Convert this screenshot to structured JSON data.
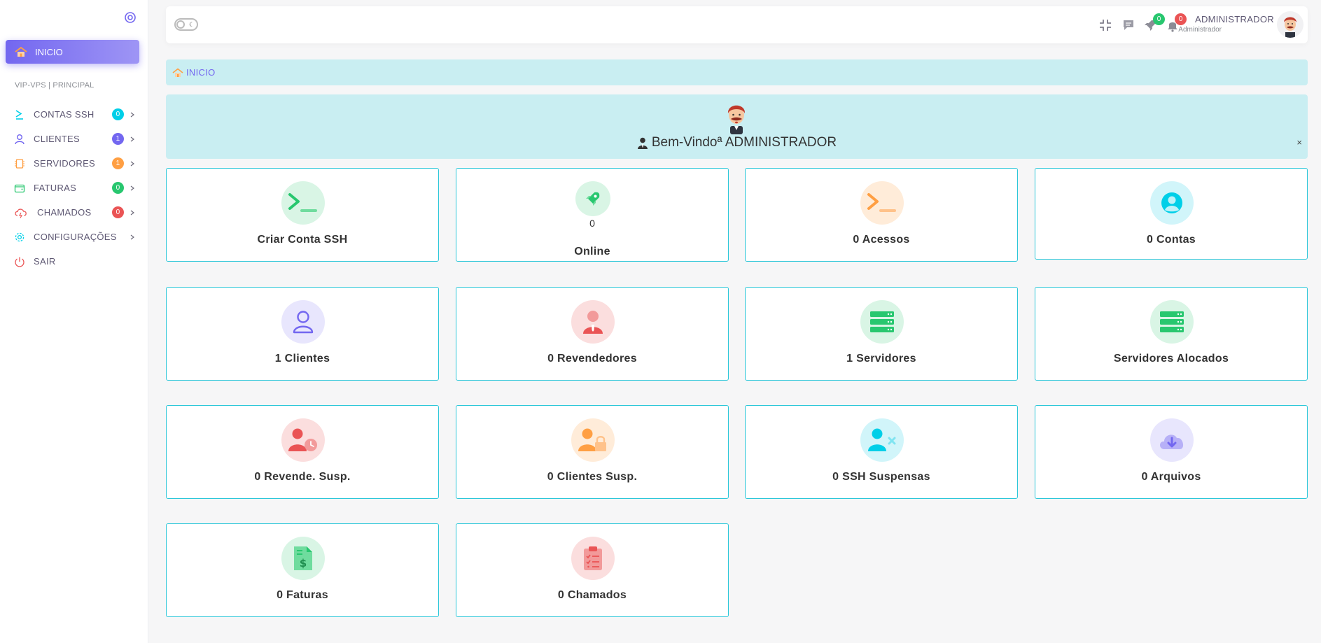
{
  "sidebar": {
    "active_item": "INICIO",
    "section_label": "VIP-VPS | PRINCIPAL",
    "items": [
      {
        "label": "CONTAS SSH",
        "icon": "terminal-icon",
        "badge": "0",
        "badge_color": "#00cfe8",
        "has_chevron": true
      },
      {
        "label": "CLIENTES",
        "icon": "user-icon",
        "badge": "1",
        "badge_color": "#7367f0",
        "has_chevron": true
      },
      {
        "label": "SERVIDORES",
        "icon": "cpu-icon",
        "badge": "1",
        "badge_color": "#ff9f43",
        "has_chevron": true
      },
      {
        "label": "FATURAS",
        "icon": "wallet-icon",
        "badge": "0",
        "badge_color": "#28c76f",
        "has_chevron": true
      },
      {
        "label": "CHAMADOS",
        "icon": "cloud-lightning-icon",
        "badge": "0",
        "badge_color": "#ea5455",
        "has_chevron": true
      },
      {
        "label": "CONFIGURAÇÕES",
        "icon": "settings-icon",
        "badge": "",
        "badge_color": "",
        "has_chevron": true
      },
      {
        "label": "SAIR",
        "icon": "power-icon",
        "badge": "",
        "badge_color": "",
        "has_chevron": false
      }
    ]
  },
  "topbar": {
    "theme_toggle_icon": "moon-icon",
    "rocket_badge": "0",
    "bell_badge": "0",
    "user_name": "ADMINISTRADOR",
    "user_role": "Administrador"
  },
  "breadcrumb": {
    "label": "INICIO"
  },
  "welcome": {
    "message": "Bem-Vindoª ADMINISTRADOR",
    "close": "×"
  },
  "cards": [
    {
      "label": "Criar Conta SSH",
      "icon": "terminal-icon",
      "color": "#28c76f",
      "bg": "#d9f5e5"
    },
    {
      "label": "Online",
      "count": "0",
      "icon": "rocket-icon",
      "color": "#28c76f",
      "bg": "#d9f5e5"
    },
    {
      "label": "0 Acessos",
      "icon": "terminal-icon",
      "color": "#ff9f43",
      "bg": "#ffecd9"
    },
    {
      "label": "0 Contas",
      "icon": "user-circle-icon",
      "color": "#00cfe8",
      "bg": "#d1f5fa"
    },
    {
      "label": "1 Clientes",
      "icon": "user-icon",
      "color": "#7367f0",
      "bg": "#e8e6fd"
    },
    {
      "label": "0 Revendedores",
      "icon": "user-tie-icon",
      "color": "#ea5455",
      "bg": "#fbdede"
    },
    {
      "label": "1 Servidores",
      "icon": "server-icon",
      "color": "#28c76f",
      "bg": "#d9f5e5"
    },
    {
      "label": "Servidores Alocados",
      "icon": "server-icon",
      "color": "#28c76f",
      "bg": "#d9f5e5"
    },
    {
      "label": "0 Revende. Susp.",
      "icon": "user-clock-icon",
      "color": "#ea5455",
      "bg": "#fbdede"
    },
    {
      "label": "0 Clientes Susp.",
      "icon": "user-lock-icon",
      "color": "#ff9f43",
      "bg": "#ffecd9"
    },
    {
      "label": "0 SSH Suspensas",
      "icon": "user-times-icon",
      "color": "#00cfe8",
      "bg": "#d1f5fa"
    },
    {
      "label": "0 Arquivos",
      "icon": "cloud-download-icon",
      "color": "#7367f0",
      "bg": "#e8e6fd"
    },
    {
      "label": "0 Faturas",
      "icon": "invoice-dollar-icon",
      "color": "#28c76f",
      "bg": "#d9f5e5"
    },
    {
      "label": "0 Chamados",
      "icon": "clipboard-list-icon",
      "color": "#ea5455",
      "bg": "#fbdede"
    }
  ]
}
